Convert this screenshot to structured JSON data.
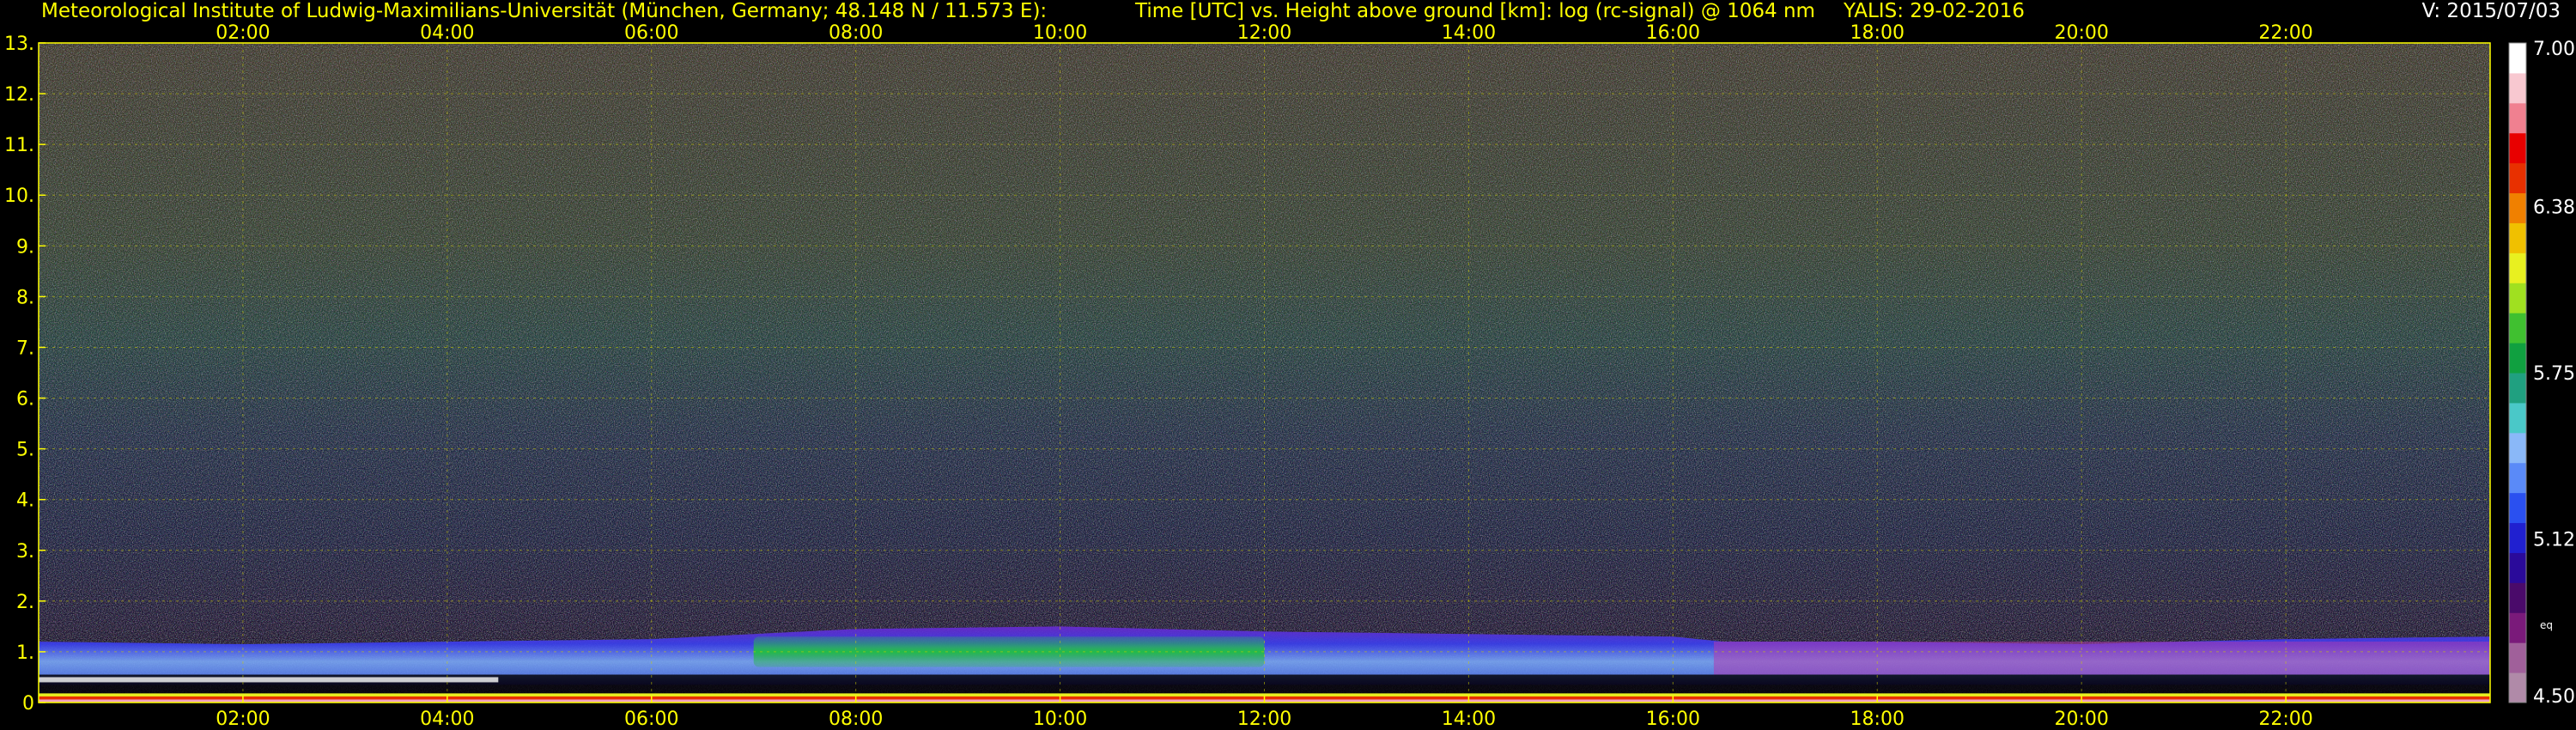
{
  "header": {
    "institute": "Meteorological Institute of Ludwig-Maximilians-Universität (München, Germany; 48.148 N / 11.573 E):",
    "axis_description": "Time [UTC] vs. Height above ground [km]: log (rc-signal) @ 1064 nm",
    "station_date": "YALIS: 29-02-2016",
    "version": "V: 2015/07/03"
  },
  "chart_data": {
    "type": "heatmap",
    "title": "",
    "xlabel": "Time [UTC]",
    "ylabel": "Height above ground [km]",
    "quantity": "log (rc-signal) @ 1064 nm",
    "x_range_hours": [
      0,
      24
    ],
    "x_ticks": [
      "02:00",
      "04:00",
      "06:00",
      "08:00",
      "10:00",
      "12:00",
      "14:00",
      "16:00",
      "18:00",
      "20:00",
      "22:00"
    ],
    "x_tick_hours": [
      2,
      4,
      6,
      8,
      10,
      12,
      14,
      16,
      18,
      20,
      22
    ],
    "y_range_km": [
      0,
      13
    ],
    "y_ticks": [
      "0",
      "1.",
      "2.",
      "3.",
      "4.",
      "5.",
      "6.",
      "7.",
      "8.",
      "9.",
      "10.",
      "11.",
      "12.",
      "13."
    ],
    "grid": true,
    "colorbar": {
      "range": [
        4.5,
        7.0
      ],
      "labels": [
        "7.00",
        "6.38",
        "5.75",
        "5.12",
        "4.50"
      ],
      "label_values": [
        7.0,
        6.38,
        5.75,
        5.12,
        4.5
      ],
      "side_label": "eq",
      "colors": [
        "#b08aa8",
        "#a0609a",
        "#7a1a7a",
        "#4a0a6a",
        "#2a0a9a",
        "#2020d0",
        "#2a50f0",
        "#5a8af8",
        "#8ab8f8",
        "#4ac8c8",
        "#20a080",
        "#10a040",
        "#40c030",
        "#a0e020",
        "#e8f020",
        "#f0c000",
        "#f08000",
        "#e83000",
        "#e80000",
        "#f08090",
        "#f8c8d0",
        "#ffffff"
      ]
    },
    "boundary_layer_top_km": [
      {
        "hour": 0.0,
        "km": 1.2
      },
      {
        "hour": 2.0,
        "km": 1.15
      },
      {
        "hour": 4.0,
        "km": 1.2
      },
      {
        "hour": 6.0,
        "km": 1.25
      },
      {
        "hour": 8.0,
        "km": 1.45
      },
      {
        "hour": 10.0,
        "km": 1.5
      },
      {
        "hour": 12.0,
        "km": 1.4
      },
      {
        "hour": 14.0,
        "km": 1.35
      },
      {
        "hour": 16.0,
        "km": 1.3
      },
      {
        "hour": 16.5,
        "km": 1.2
      },
      {
        "hour": 18.0,
        "km": 1.2
      },
      {
        "hour": 20.0,
        "km": 1.15
      },
      {
        "hour": 22.0,
        "km": 1.25
      },
      {
        "hour": 24.0,
        "km": 1.3
      }
    ]
  }
}
